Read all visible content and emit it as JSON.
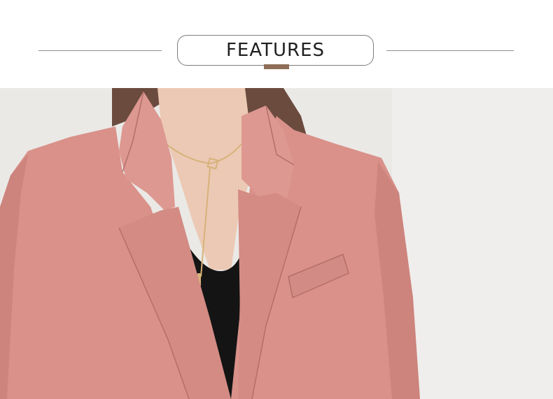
{
  "header": {
    "title": "FEATURES",
    "rule_color": "#8f8f8f",
    "accent_color": "#8e6e58"
  },
  "photo": {
    "subject": "pink-blazer",
    "colors": {
      "background": "#eae9e6",
      "blazer": "#d9918a",
      "blazer_shadow": "#c37a73",
      "skin": "#ecc9b4",
      "hair": "#6b4b3e",
      "top": "#141414",
      "necklace": "#d7b27a"
    }
  }
}
